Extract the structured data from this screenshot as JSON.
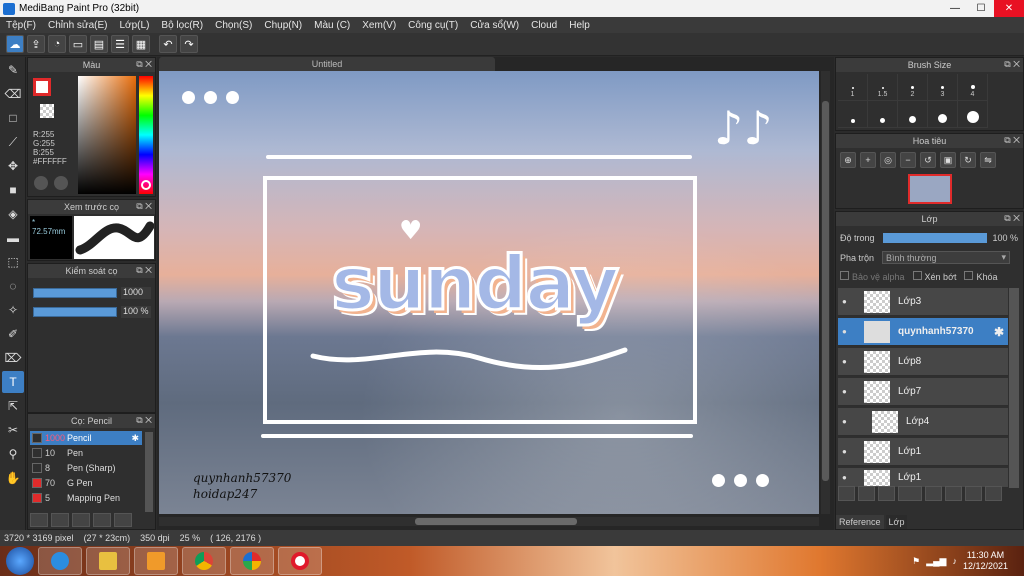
{
  "window": {
    "title": "MediBang Paint Pro (32bit)"
  },
  "menu": [
    "Tệp(F)",
    "Chỉnh sửa(E)",
    "Lớp(L)",
    "Bộ lọc(R)",
    "Chọn(S)",
    "Chụp(N)",
    "Màu (C)",
    "Xem(V)",
    "Công cụ(T)",
    "Cửa sổ(W)",
    "Cloud",
    "Help"
  ],
  "color_panel": {
    "title": "Màu",
    "r": "R:255",
    "g": "G:255",
    "b": "B:255",
    "hex": "#FFFFFF",
    "main_color": "#e0292a"
  },
  "brush_preview": {
    "title": "Xem trước cọ",
    "size": "72.57mm"
  },
  "brush_control": {
    "title": "Kiểm soát cọ",
    "size_value": "1000",
    "opacity_value": "100 %"
  },
  "brush_list": {
    "title": "Cọ: Pencil",
    "items": [
      {
        "size": "1000",
        "name": "Pencil",
        "color": "#2f2f2f"
      },
      {
        "size": "10",
        "name": "Pen",
        "color": "#2f2f2f"
      },
      {
        "size": "8",
        "name": "Pen (Sharp)",
        "color": "#2f2f2f"
      },
      {
        "size": "70",
        "name": "G Pen",
        "color": "#e02b2b"
      },
      {
        "size": "5",
        "name": "Mapping Pen",
        "color": "#e02b2b"
      }
    ]
  },
  "canvas": {
    "tab": "Untitled",
    "artwork_text": "sunday",
    "notes": "♪♪",
    "heart": "♥",
    "watermark_1": "quynhanh57370",
    "watermark_2": "hoidap247"
  },
  "brush_size": {
    "title": "Brush Size",
    "sizes": [
      "1",
      "1.5",
      "2",
      "3",
      "4"
    ]
  },
  "navigator": {
    "title": "Hoa tiêu"
  },
  "layers": {
    "title": "Lớp",
    "opacity_label": "Độ trong",
    "opacity_value": "100 %",
    "blend_label": "Pha trộn",
    "blend_value": "Bình thường",
    "protect_alpha": "Bảo vệ alpha",
    "clipping": "Xén bớt",
    "lock": "Khóa",
    "items": [
      "Lớp3",
      "quynhanh57370",
      "Lớp8",
      "Lớp7",
      "Lớp4",
      "Lớp1",
      "Lớp1"
    ],
    "tab_reference": "Reference",
    "tab_layer": "Lớp"
  },
  "status": {
    "size": "3720 * 3169 pixel",
    "physical": "(27 * 23cm)",
    "dpi": "350 dpi",
    "zoom": "25 %",
    "coords": "( 126, 2176 )"
  },
  "taskbar": {
    "time": "11:30 AM",
    "date": "12/12/2021"
  }
}
